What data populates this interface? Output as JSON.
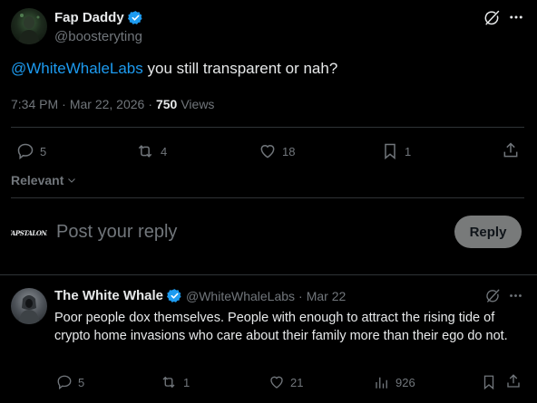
{
  "main_tweet": {
    "author_name": "Fap Daddy",
    "author_handle": "@boosteryting",
    "mention": "@WhiteWhaleLabs",
    "text": " you still transparent or nah?",
    "time": "7:34 PM",
    "date": "Mar 22, 2026",
    "views_count": "750",
    "views_label": "Views",
    "replies": "5",
    "retweets": "4",
    "likes": "18",
    "bookmarks": "1"
  },
  "sort": {
    "label": "Relevant"
  },
  "composer": {
    "avatar_text": "FAPSTALONE",
    "placeholder": "Post your reply",
    "reply_button": "Reply"
  },
  "reply_tweet": {
    "author_name": "The White Whale",
    "author_handle": "@WhiteWhaleLabs",
    "separator": "·",
    "date": "Mar 22",
    "text": "Poor people dox themselves. People with enough to attract the rising tide of crypto home invasions who care about their family more than their ego do not.",
    "replies": "5",
    "retweets": "1",
    "likes": "21",
    "views": "926"
  },
  "colors": {
    "accent": "#1d9bf0",
    "background": "#000000",
    "muted": "#71767b",
    "divider": "#2f3336"
  }
}
